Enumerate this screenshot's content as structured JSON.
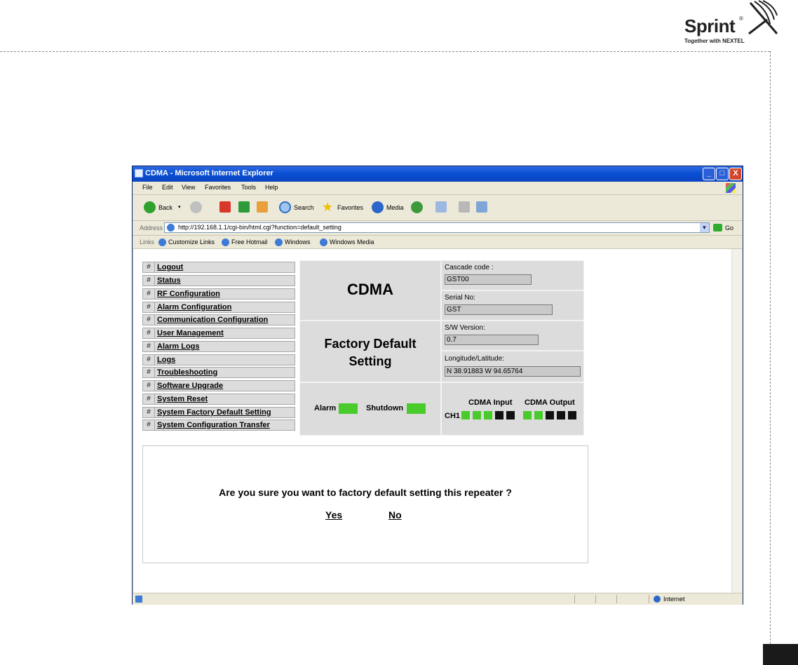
{
  "brand": {
    "name": "Sprint",
    "registered": "®",
    "tagline": "Together with NEXTEL"
  },
  "window": {
    "title": "CDMA - Microsoft Internet Explorer",
    "controls": {
      "minimize": "_",
      "maximize": "□",
      "close": "X"
    }
  },
  "menu": [
    "File",
    "Edit",
    "View",
    "Favorites",
    "Tools",
    "Help"
  ],
  "toolbar": {
    "back": "Back",
    "search": "Search",
    "favorites": "Favorites",
    "media": "Media"
  },
  "address": {
    "label": "Address",
    "url": "http://192.168.1.1/cgi-bin/html.cgi?function=default_setting",
    "go": "Go"
  },
  "links": {
    "label": "Links",
    "items": [
      "Customize Links",
      "Free Hotmail",
      "Windows",
      "Windows Media"
    ]
  },
  "nav": {
    "hash": "#",
    "items": [
      "Logout",
      "Status",
      "RF Configuration",
      "Alarm Configuration",
      "Communication Configuration",
      "User Management",
      "Alarm Logs",
      "Logs",
      "Troubleshooting",
      "Software Upgrade",
      "System Reset",
      "System Factory Default Setting",
      "System Configuration Transfer"
    ]
  },
  "panel": {
    "title": "CDMA",
    "subtitle_line1": "Factory Default",
    "subtitle_line2": "Setting",
    "cascade_label": "Cascade code :",
    "cascade_value": "GST00",
    "serial_label": "Serial No:",
    "serial_value": "GST",
    "sw_label": "S/W Version:",
    "sw_value": "0.7",
    "geo_label": "Longitude/Latitude:",
    "geo_value": "N 38.91883 W 94.65764",
    "alarm_label": "Alarm",
    "shutdown_label": "Shutdown",
    "cdma_input_label": "CDMA Input",
    "cdma_output_label": "CDMA Output",
    "channel_label": "CH1",
    "led_colors": {
      "on": "#49cc2b",
      "off": "#111111"
    }
  },
  "confirm": {
    "question": "Are you sure you want to factory default setting this repeater ?",
    "yes": "Yes",
    "no": "No"
  },
  "status": {
    "zone": "Internet"
  }
}
